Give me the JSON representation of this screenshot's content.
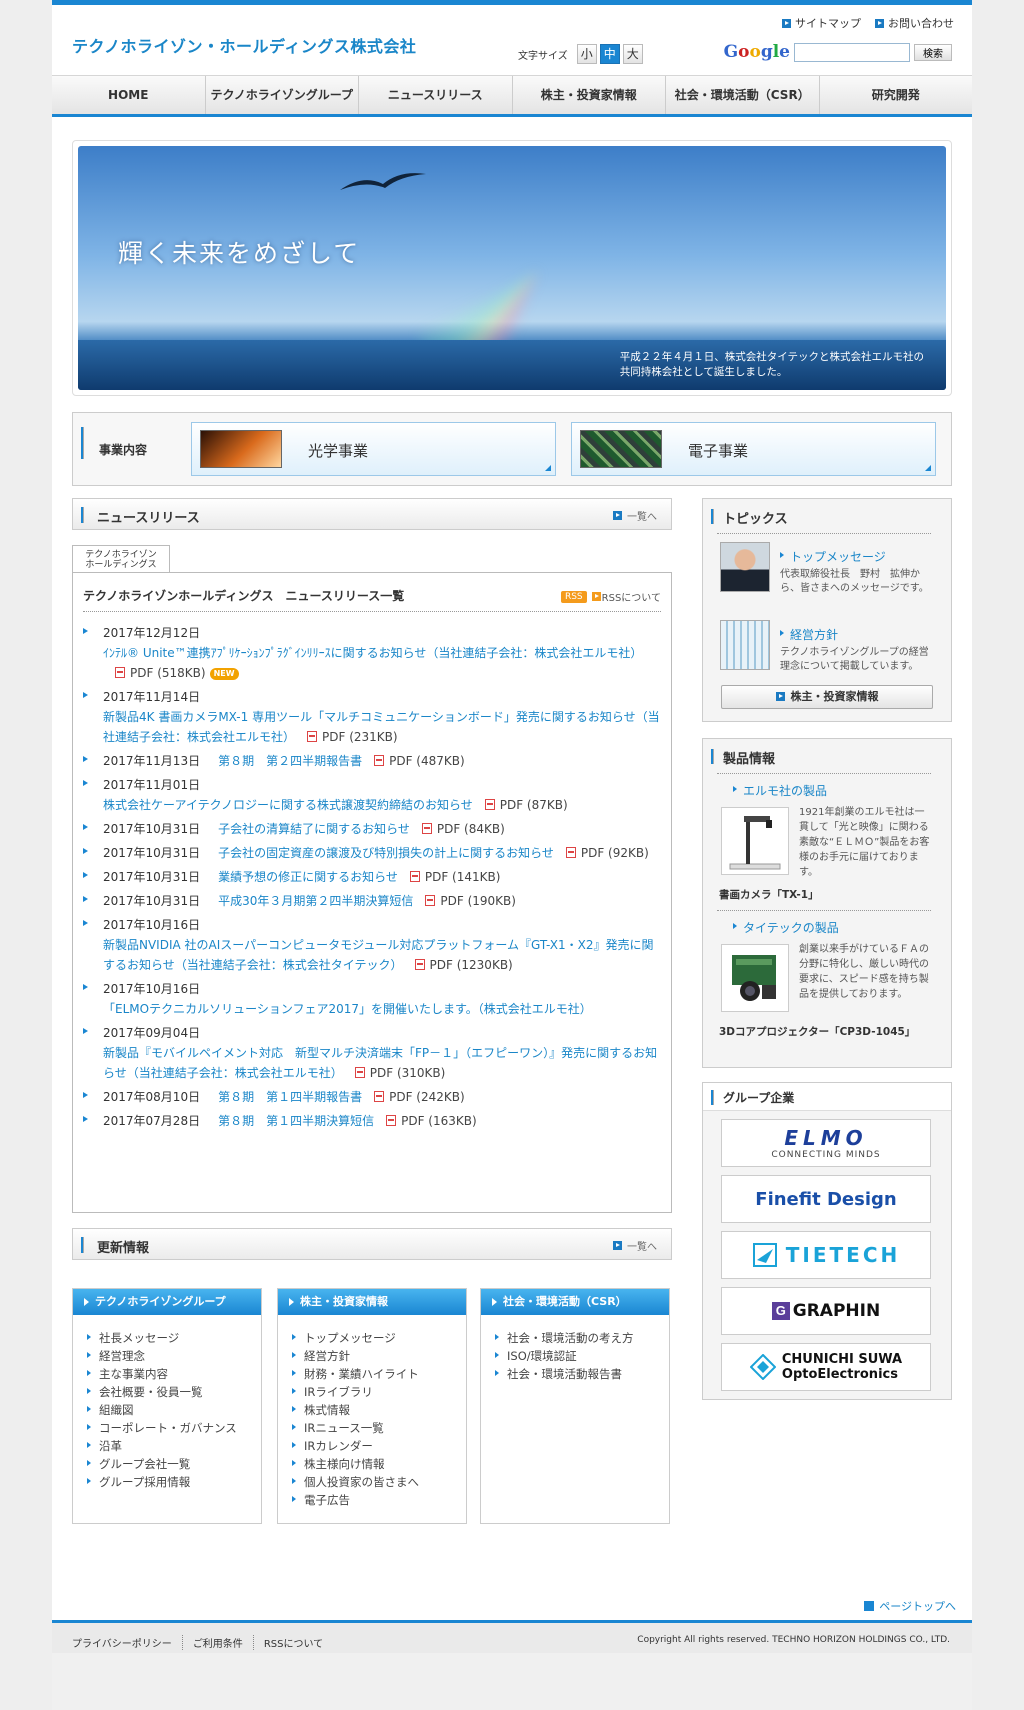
{
  "header": {
    "logo": "テクノホライゾン・ホールディングス株式会社",
    "util_links": [
      "サイトマップ",
      "お問い合わせ"
    ],
    "font_size_label": "文字サイズ",
    "font_sizes": [
      "小",
      "中",
      "大"
    ],
    "font_size_selected": "中",
    "search_button": "検索",
    "search_value": ""
  },
  "gnav": [
    "HOME",
    "テクノホライゾングループ",
    "ニュースリリース",
    "株主・投資家情報",
    "社会・環境活動（CSR）",
    "研究開発"
  ],
  "hero": {
    "title": "輝く未来をめざして",
    "note_line1": "平成２２年４月１日、株式会社タイテックと株式会社エルモ社の",
    "note_line2": "共同持株会社として誕生しました。"
  },
  "business": {
    "label": "事業内容",
    "items": [
      "光学事業",
      "電子事業"
    ]
  },
  "news": {
    "heading": "ニュースリリース",
    "more": "一覧へ",
    "tab_line1": "テクノホライゾン",
    "tab_line2": "ホールディングス",
    "box_title": "テクノホライゾンホールディングス　ニュースリリース一覧",
    "rss_badge": "RSS",
    "rss_link": "RSSについて",
    "items": [
      {
        "date": "2017年12月12日",
        "title": "ｲﾝﾃﾙ® Unite™連携ｱﾌﾟﾘｹｰｼｮﾝﾌﾟﾗｸﾞｲﾝﾘﾘｰｽに関するお知らせ（当社連結子会社：株式会社エルモ社）",
        "pdf": "PDF (518KB)",
        "new": "NEW"
      },
      {
        "date": "2017年11月14日",
        "title": "新製品4K 書画カメラMX-1 専用ツール「マルチコミュニケーションボード」発売に関するお知らせ（当社連結子会社：株式会社エルモ社）",
        "pdf": "PDF (231KB)"
      },
      {
        "date": "2017年11月13日",
        "title": "第８期　第２四半期報告書",
        "pdf": "PDF (487KB)"
      },
      {
        "date": "2017年11月01日",
        "title": "株式会社ケーアイテクノロジーに関する株式譲渡契約締結のお知らせ",
        "pdf": "PDF (87KB)"
      },
      {
        "date": "2017年10月31日",
        "title": "子会社の清算結了に関するお知らせ",
        "pdf": "PDF (84KB)"
      },
      {
        "date": "2017年10月31日",
        "title": "子会社の固定資産の譲渡及び特別損失の計上に関するお知らせ",
        "pdf": "PDF (92KB)"
      },
      {
        "date": "2017年10月31日",
        "title": "業績予想の修正に関するお知らせ",
        "pdf": "PDF (141KB)"
      },
      {
        "date": "2017年10月31日",
        "title": "平成30年３月期第２四半期決算短信",
        "pdf": "PDF (190KB)"
      },
      {
        "date": "2017年10月16日",
        "title": "新製品NVIDIA 社のAIスーパーコンピュータモジュール対応プラットフォーム『GT-X1・X2』発売に関するお知らせ（当社連結子会社：株式会社タイテック）",
        "pdf": "PDF (1230KB)"
      },
      {
        "date": "2017年10月16日",
        "title": "「ELMOテクニカルソリューションフェア2017」を開催いたします。（株式会社エルモ社）"
      },
      {
        "date": "2017年09月04日",
        "title": "新製品『モバイルペイメント対応　新型マルチ決済端末「FP－１」（エフピーワン）』発売に関するお知らせ（当社連結子会社：株式会社エルモ社）",
        "pdf": "PDF (310KB)"
      },
      {
        "date": "2017年08月10日",
        "title": "第８期　第１四半期報告書",
        "pdf": "PDF (242KB)"
      },
      {
        "date": "2017年07月28日",
        "title": "第８期　第１四半期決算短信",
        "pdf": "PDF (163KB)"
      }
    ]
  },
  "updates": {
    "heading": "更新情報",
    "more": "一覧へ"
  },
  "footer_boxes": [
    {
      "title": "テクノホライゾングループ",
      "links": [
        "社長メッセージ",
        "経営理念",
        "主な事業内容",
        "会社概要・役員一覧",
        "組織図",
        "コーポレート・ガバナンス",
        "沿革",
        "グループ会社一覧",
        "グループ採用情報"
      ]
    },
    {
      "title": "株主・投資家情報",
      "links": [
        "トップメッセージ",
        "経営方針",
        "財務・業績ハイライト",
        "IRライブラリ",
        "株式情報",
        "IRニュース一覧",
        "IRカレンダー",
        "株主様向け情報",
        "個人投資家の皆さまへ",
        "電子広告"
      ]
    },
    {
      "title": "社会・環境活動（CSR）",
      "links": [
        "社会・環境活動の考え方",
        "ISO/環境認証",
        "社会・環境活動報告書"
      ]
    }
  ],
  "topics": {
    "heading": "トピックス",
    "items": [
      {
        "title": "トップメッセージ",
        "desc": "代表取締役社長　野村　拡伸から、皆さまへのメッセージです。"
      },
      {
        "title": "経営方針",
        "desc": "テクノホライゾングループの経営理念について掲載しています。"
      }
    ],
    "ir_button": "株主・投資家情報"
  },
  "products": {
    "heading": "製品情報",
    "items": [
      {
        "title": "エルモ社の製品",
        "desc": "1921年創業のエルモ社は一貫して「光と映像」に関わる素敵な“ＥＬＭＯ”製品をお客様のお手元に届けております。",
        "caption": "書画カメラ「TX-1」"
      },
      {
        "title": "タイテックの製品",
        "desc": "創業以来手がけているＦＡの分野に特化し、厳しい時代の要求に、スピード感を持ち製品を提供しております。",
        "caption": "3Dコアプロジェクター「CP3D-1045」"
      }
    ]
  },
  "group": {
    "heading": "グループ企業",
    "logos": [
      {
        "name": "ELMO",
        "sub": "CONNECTING MINDS"
      },
      {
        "name": "Finefit Design"
      },
      {
        "name": "TIETECH"
      },
      {
        "name": "GRAPHIN"
      },
      {
        "name": "CHUNICHI SUWA",
        "sub": "OptoElectronics"
      }
    ]
  },
  "page_top": "ページトップへ",
  "footer": {
    "links": [
      "プライバシーポリシー",
      "ご利用条件",
      "RSSについて"
    ],
    "copyright": "Copyright All rights reserved. TECHNO HORIZON HOLDINGS CO., LTD."
  },
  "colors": {
    "accent": "#1a86d2",
    "link": "#1a86c8",
    "new_badge": "#f2a200",
    "rss": "#f49b1c"
  }
}
